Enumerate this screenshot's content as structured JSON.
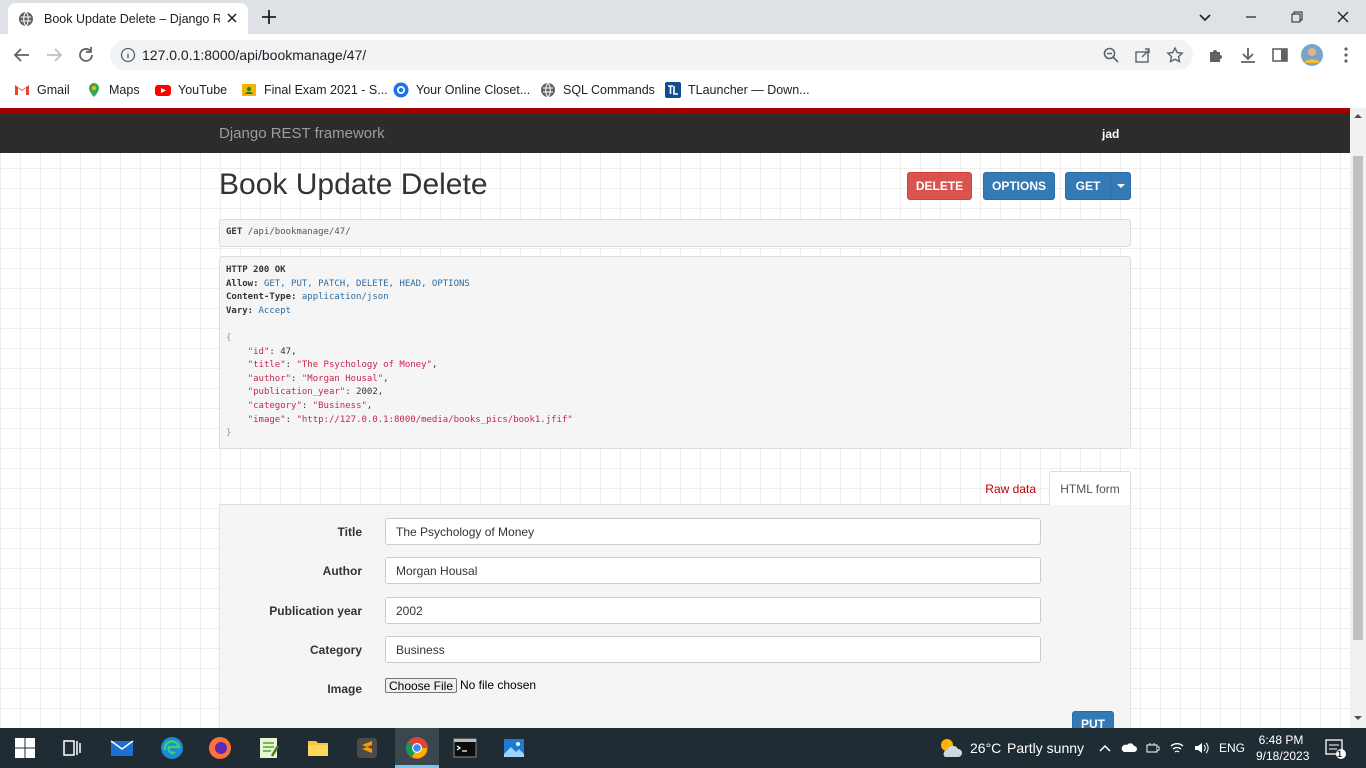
{
  "browser": {
    "tab_title": "Book Update Delete – Django RE",
    "url": "127.0.0.1:8000/api/bookmanage/47/",
    "bookmarks": [
      {
        "label": "Gmail",
        "icon": "gmail-icon"
      },
      {
        "label": "Maps",
        "icon": "maps-icon"
      },
      {
        "label": "YouTube",
        "icon": "youtube-icon"
      },
      {
        "label": "Final Exam 2021 - S...",
        "icon": "classroom-icon"
      },
      {
        "label": "Your Online Closet...",
        "icon": "closet-icon"
      },
      {
        "label": "SQL Commands",
        "icon": "globe-icon"
      },
      {
        "label": "TLauncher — Down...",
        "icon": "tlauncher-icon"
      }
    ]
  },
  "app": {
    "brand": "Django REST framework",
    "user": "jad",
    "title": "Book Update Delete",
    "buttons": {
      "delete": "DELETE",
      "options": "OPTIONS",
      "get": "GET",
      "put": "PUT"
    },
    "request": {
      "method": "GET",
      "path": "/api/bookmanage/47/"
    },
    "response": {
      "status": "HTTP 200 OK",
      "headers": [
        {
          "key": "Allow:",
          "value": "GET, PUT, PATCH, DELETE, HEAD, OPTIONS"
        },
        {
          "key": "Content-Type:",
          "value": "application/json"
        },
        {
          "key": "Vary:",
          "value": "Accept"
        }
      ],
      "open_brace": "{",
      "close_brace": "}",
      "body": [
        {
          "key": "\"id\"",
          "value": "47",
          "type": "num"
        },
        {
          "key": "\"title\"",
          "value": "\"The Psychology of Money\"",
          "type": "str"
        },
        {
          "key": "\"author\"",
          "value": "\"Morgan Housal\"",
          "type": "str"
        },
        {
          "key": "\"publication_year\"",
          "value": "2002",
          "type": "num"
        },
        {
          "key": "\"category\"",
          "value": "\"Business\"",
          "type": "str"
        },
        {
          "key": "\"image\"",
          "value": "\"http://127.0.0.1:8000/media/books_pics/book1.jfif\"",
          "type": "str",
          "last": true
        }
      ]
    },
    "tabs": {
      "raw": "Raw data",
      "html": "HTML form"
    },
    "form": {
      "title_label": "Title",
      "title_value": "The Psychology of Money",
      "author_label": "Author",
      "author_value": "Morgan Housal",
      "year_label": "Publication year",
      "year_value": "2002",
      "category_label": "Category",
      "category_value": "Business",
      "image_label": "Image",
      "file_button": "Choose File",
      "file_status": "No file chosen"
    }
  },
  "taskbar": {
    "temperature": "26°C",
    "weather": "Partly sunny",
    "language": "ENG",
    "time": "6:48 PM",
    "date": "9/18/2023",
    "notifications": "1"
  }
}
